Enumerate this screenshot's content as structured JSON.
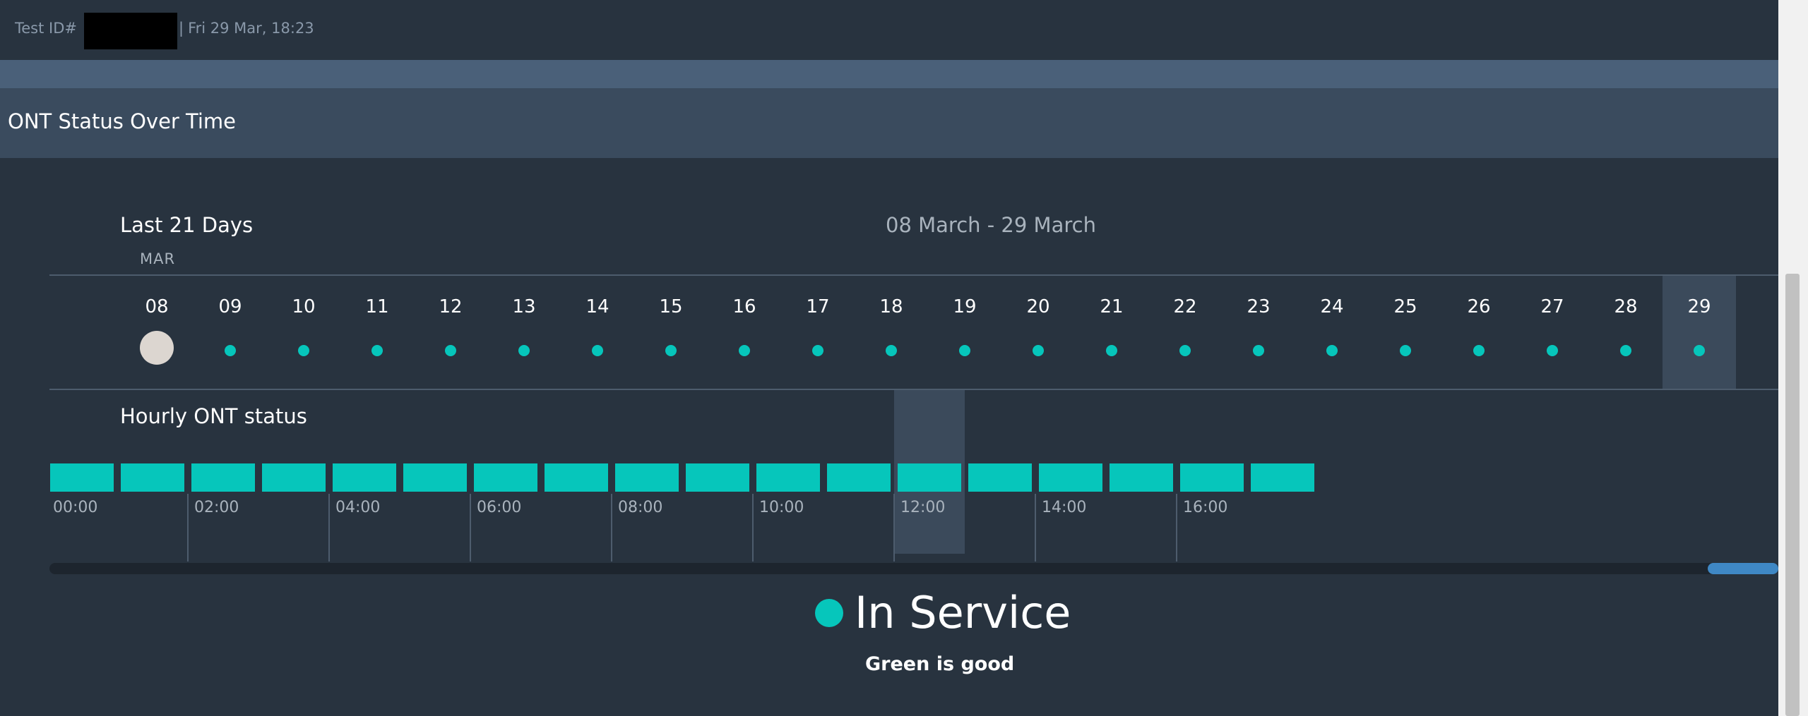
{
  "header": {
    "test_id_label": "Test ID#",
    "separator": "|",
    "timestamp": "Fri 29 Mar, 18:23"
  },
  "section": {
    "title": "ONT Status Over Time"
  },
  "daily": {
    "range_label": "Last 21 Days",
    "date_range": "08 March - 29 March",
    "month": "MAR",
    "days": [
      "08",
      "09",
      "10",
      "11",
      "12",
      "13",
      "14",
      "15",
      "16",
      "17",
      "18",
      "19",
      "20",
      "21",
      "22",
      "23",
      "24",
      "25",
      "26",
      "27",
      "28",
      "29"
    ],
    "selected_day": "08",
    "highlighted_day": "29"
  },
  "hourly": {
    "label": "Hourly ONT status",
    "hour_labels": [
      "00:00",
      "02:00",
      "04:00",
      "06:00",
      "08:00",
      "10:00",
      "12:00",
      "14:00",
      "16:00"
    ],
    "blocks_count": 18,
    "highlighted_hour": "12:00"
  },
  "legend": {
    "status": "In Service",
    "note": "Green is good",
    "color": "#06c6bb"
  },
  "colors": {
    "status_green": "#06c6bb",
    "selected_day": "#dcd6d0",
    "scroll_thumb": "#3f88c5"
  }
}
